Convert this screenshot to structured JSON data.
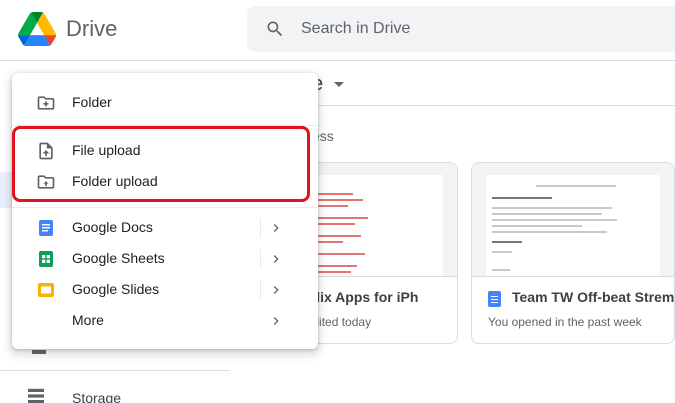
{
  "header": {
    "app_name": "Drive",
    "search_placeholder": "Search in Drive"
  },
  "background": {
    "breadcrumb_fragment": "e",
    "section_fragment": "ess",
    "cards": [
      {
        "title": "Netflix Apps for iPh",
        "subtitle": "na edited today"
      },
      {
        "title": "Team TW Off-beat Strem",
        "subtitle": "You opened in the past week"
      }
    ],
    "sidebar_storage": "Storage"
  },
  "new_menu": {
    "items": [
      {
        "label": "Folder",
        "icon": "folder-plus-icon"
      },
      {
        "label": "File upload",
        "icon": "file-upload-icon"
      },
      {
        "label": "Folder upload",
        "icon": "folder-upload-icon"
      },
      {
        "label": "Google Docs",
        "icon": "google-docs-icon",
        "submenu": true
      },
      {
        "label": "Google Sheets",
        "icon": "google-sheets-icon",
        "submenu": true
      },
      {
        "label": "Google Slides",
        "icon": "google-slides-icon",
        "submenu": true
      },
      {
        "label": "More",
        "icon": "",
        "submenu": true
      }
    ]
  },
  "colors": {
    "highlight_border": "#e0141e",
    "docs_blue": "#4285f4",
    "sheets_green": "#0f9d58",
    "slides_yellow": "#f4b400"
  }
}
